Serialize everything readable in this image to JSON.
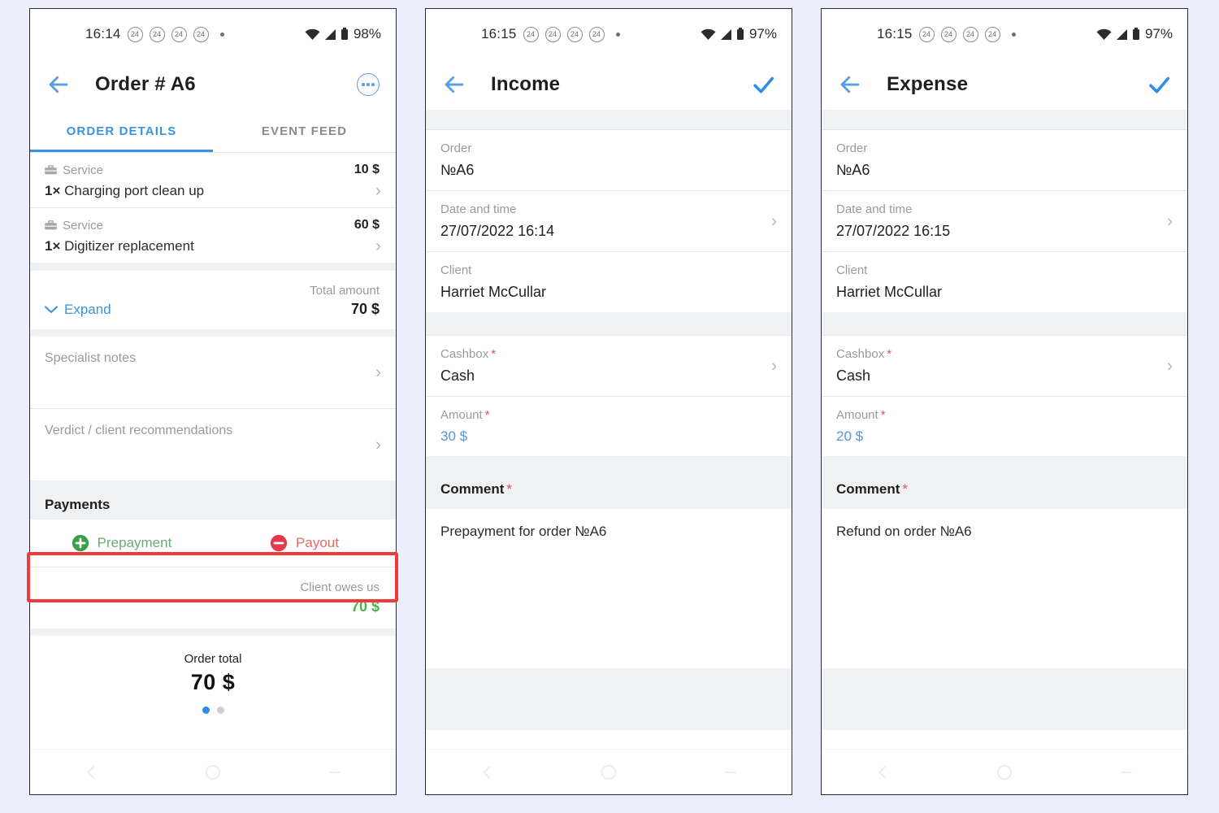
{
  "theme": {
    "page_bg": "#eceffb",
    "accent_blue": "#3a93e0",
    "green": "#4caf50",
    "red": "#e06b6b",
    "annotation_red": "#ee3b3b",
    "muted": "#9a9a9a"
  },
  "panel1": {
    "status_bar": {
      "clock": "16:14",
      "badges": [
        "24",
        "24",
        "24",
        "24"
      ],
      "battery_percent": "98%",
      "icons": [
        "wifi-icon",
        "cellular-signal-icon",
        "battery-icon"
      ]
    },
    "appbar": {
      "back_icon": "back-arrow-icon",
      "title": "Order # A6",
      "overflow_icon": "more-options-icon"
    },
    "tabs": [
      {
        "label": "ORDER DETAILS",
        "active": true
      },
      {
        "label": "EVENT FEED",
        "active": false
      }
    ],
    "services": [
      {
        "type_label": "Service",
        "price": "10 $",
        "qty": "1×",
        "name": "Charging port clean up",
        "chevron": "chevron-right-icon",
        "icon": "briefcase-icon"
      },
      {
        "type_label": "Service",
        "price": "60 $",
        "qty": "1×",
        "name": "Digitizer replacement",
        "chevron": "chevron-right-icon",
        "icon": "briefcase-icon"
      }
    ],
    "expand": {
      "label": "Expand",
      "chevron": "chevron-down-icon",
      "total_label": "Total amount",
      "total_value": "70 $"
    },
    "notes": [
      {
        "label": "Specialist notes",
        "chevron": "chevron-right-icon"
      },
      {
        "label": "Verdict / client recommendations",
        "chevron": "chevron-right-icon"
      }
    ],
    "payments": {
      "section_title": "Payments",
      "prepayment_label": "Prepayment",
      "prepayment_icon": "plus-circle-icon",
      "payout_label": "Payout",
      "payout_icon": "minus-circle-icon"
    },
    "balance": {
      "label": "Client owes us",
      "value": "70 $"
    },
    "order_total": {
      "label": "Order total",
      "value": "70 $"
    },
    "pager": {
      "total": 2,
      "current": 1
    },
    "nav_bar": [
      "back-icon",
      "home-icon",
      "recents-icon"
    ]
  },
  "panel2": {
    "status_bar": {
      "clock": "16:15",
      "badges": [
        "24",
        "24",
        "24",
        "24"
      ],
      "battery_percent": "97%",
      "icons": [
        "wifi-icon",
        "cellular-signal-icon",
        "battery-icon"
      ]
    },
    "appbar": {
      "back_icon": "back-arrow-icon",
      "title": "Income",
      "confirm_icon": "check-icon"
    },
    "fields": [
      {
        "label": "Order",
        "required": false,
        "value": "№A6",
        "chevron": null,
        "value_style": "plain"
      },
      {
        "label": "Date and time",
        "required": false,
        "value": "27/07/2022 16:14",
        "chevron": "chevron-right-icon",
        "value_style": "plain"
      },
      {
        "label": "Client",
        "required": false,
        "value": "Harriet McCullar",
        "chevron": null,
        "value_style": "plain"
      }
    ],
    "fields2": [
      {
        "label": "Cashbox",
        "required": true,
        "value": "Cash",
        "chevron": "chevron-right-icon",
        "value_style": "plain"
      },
      {
        "label": "Amount",
        "required": true,
        "value": "30 $",
        "chevron": null,
        "value_style": "blue"
      }
    ],
    "comment": {
      "title": "Comment",
      "required": true,
      "text": "Prepayment for order №A6"
    },
    "nav_bar": [
      "back-icon",
      "home-icon",
      "recents-icon"
    ]
  },
  "panel3": {
    "status_bar": {
      "clock": "16:15",
      "badges": [
        "24",
        "24",
        "24",
        "24"
      ],
      "battery_percent": "97%",
      "icons": [
        "wifi-icon",
        "cellular-signal-icon",
        "battery-icon"
      ]
    },
    "appbar": {
      "back_icon": "back-arrow-icon",
      "title": "Expense",
      "confirm_icon": "check-icon"
    },
    "fields": [
      {
        "label": "Order",
        "required": false,
        "value": "№A6",
        "chevron": null,
        "value_style": "plain"
      },
      {
        "label": "Date and time",
        "required": false,
        "value": "27/07/2022 16:15",
        "chevron": "chevron-right-icon",
        "value_style": "plain"
      },
      {
        "label": "Client",
        "required": false,
        "value": "Harriet McCullar",
        "chevron": null,
        "value_style": "plain"
      }
    ],
    "fields2": [
      {
        "label": "Cashbox",
        "required": true,
        "value": "Cash",
        "chevron": "chevron-right-icon",
        "value_style": "plain"
      },
      {
        "label": "Amount",
        "required": true,
        "value": "20 $",
        "chevron": null,
        "value_style": "blue"
      }
    ],
    "comment": {
      "title": "Comment",
      "required": true,
      "text": "Refund on order №A6"
    },
    "nav_bar": [
      "back-icon",
      "home-icon",
      "recents-icon"
    ]
  },
  "glyphs": {
    "chevron_right": "›",
    "chevron_down": "⌄",
    "required_mark": "*"
  }
}
